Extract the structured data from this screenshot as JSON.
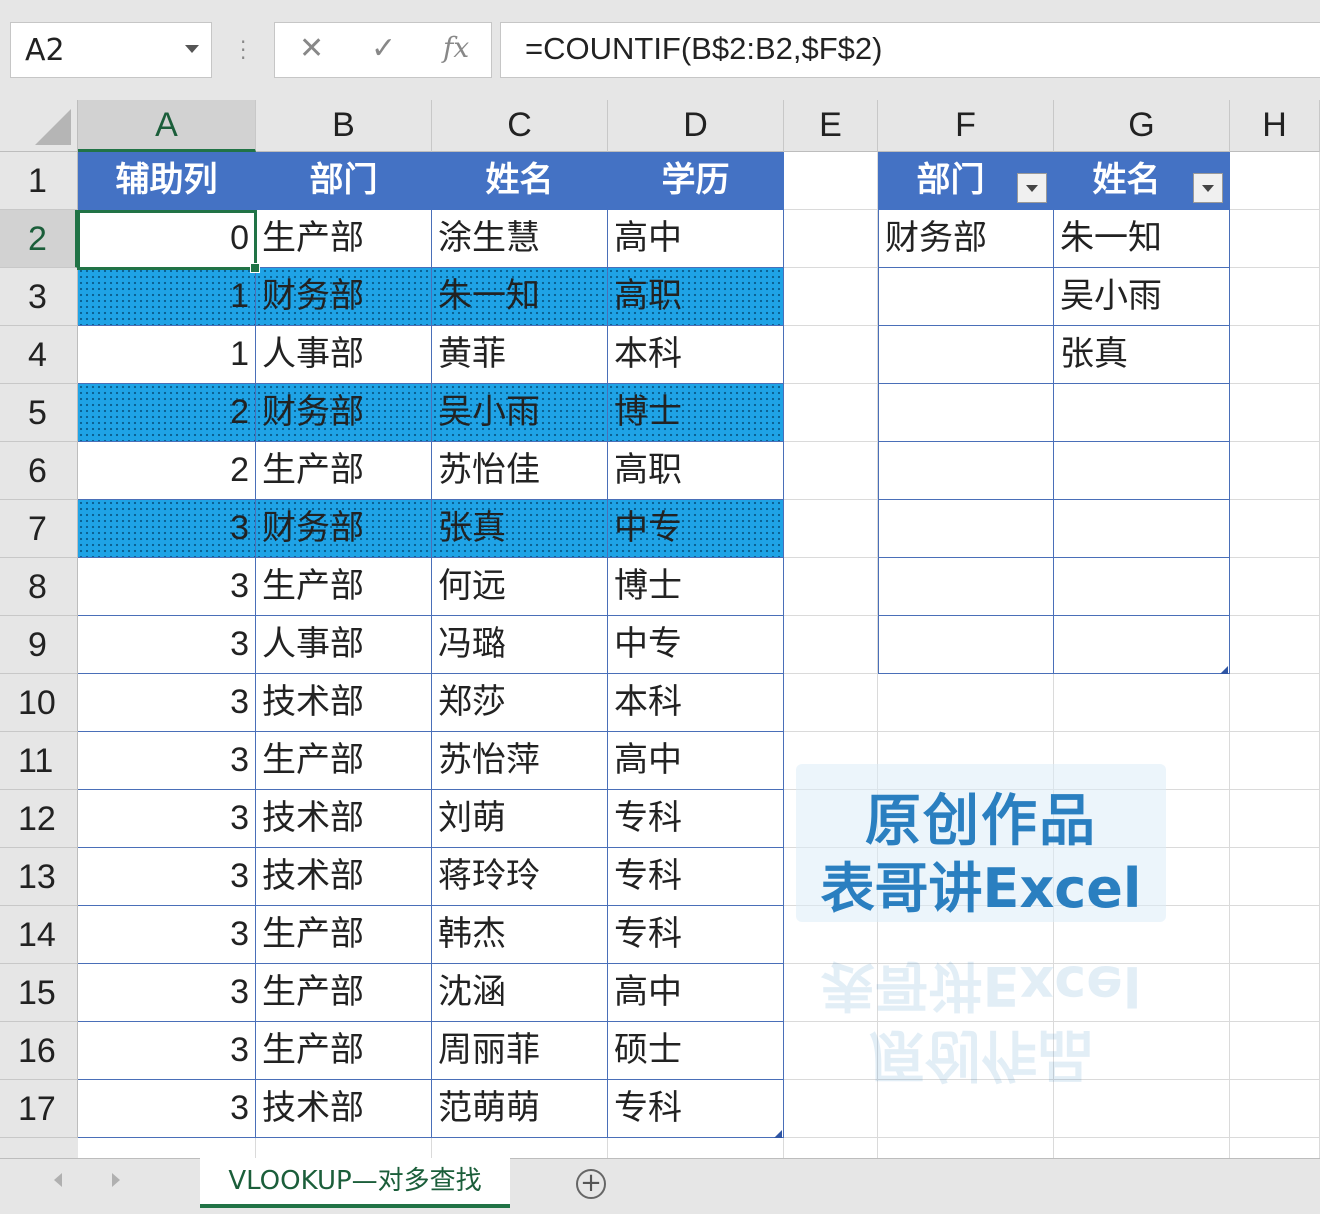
{
  "formula_bar": {
    "name_box": "A2",
    "cancel_glyph": "✕",
    "confirm_glyph": "✓",
    "fx_label": "fx",
    "formula": "=COUNTIF(B$2:B2,$F$2)"
  },
  "columns": [
    "A",
    "B",
    "C",
    "D",
    "E",
    "F",
    "G",
    "H"
  ],
  "rows": [
    "1",
    "2",
    "3",
    "4",
    "5",
    "6",
    "7",
    "8",
    "9",
    "10",
    "11",
    "12",
    "13",
    "14",
    "15",
    "16",
    "17"
  ],
  "main_table": {
    "headers": [
      "辅助列",
      "部门",
      "姓名",
      "学历"
    ],
    "rows": [
      {
        "helper": "0",
        "dept": "生产部",
        "name": "涂生慧",
        "edu": "高中",
        "highlight": false
      },
      {
        "helper": "1",
        "dept": "财务部",
        "name": "朱一知",
        "edu": "高职",
        "highlight": true
      },
      {
        "helper": "1",
        "dept": "人事部",
        "name": "黄菲",
        "edu": "本科",
        "highlight": false
      },
      {
        "helper": "2",
        "dept": "财务部",
        "name": "吴小雨",
        "edu": "博士",
        "highlight": true
      },
      {
        "helper": "2",
        "dept": "生产部",
        "name": "苏怡佳",
        "edu": "高职",
        "highlight": false
      },
      {
        "helper": "3",
        "dept": "财务部",
        "name": "张真",
        "edu": "中专",
        "highlight": true
      },
      {
        "helper": "3",
        "dept": "生产部",
        "name": "何远",
        "edu": "博士",
        "highlight": false
      },
      {
        "helper": "3",
        "dept": "人事部",
        "name": "冯璐",
        "edu": "中专",
        "highlight": false
      },
      {
        "helper": "3",
        "dept": "技术部",
        "name": "郑莎",
        "edu": "本科",
        "highlight": false
      },
      {
        "helper": "3",
        "dept": "生产部",
        "name": "苏怡萍",
        "edu": "高中",
        "highlight": false
      },
      {
        "helper": "3",
        "dept": "技术部",
        "name": "刘萌",
        "edu": "专科",
        "highlight": false
      },
      {
        "helper": "3",
        "dept": "技术部",
        "name": "蒋玲玲",
        "edu": "专科",
        "highlight": false
      },
      {
        "helper": "3",
        "dept": "生产部",
        "name": "韩杰",
        "edu": "专科",
        "highlight": false
      },
      {
        "helper": "3",
        "dept": "生产部",
        "name": "沈涵",
        "edu": "高中",
        "highlight": false
      },
      {
        "helper": "3",
        "dept": "生产部",
        "name": "周丽菲",
        "edu": "硕士",
        "highlight": false
      },
      {
        "helper": "3",
        "dept": "技术部",
        "name": "范萌萌",
        "edu": "专科",
        "highlight": false
      }
    ]
  },
  "lookup_table": {
    "headers": [
      "部门",
      "姓名"
    ],
    "rows": [
      {
        "dept": "财务部",
        "name": "朱一知"
      },
      {
        "dept": "",
        "name": "吴小雨"
      },
      {
        "dept": "",
        "name": "张真"
      },
      {
        "dept": "",
        "name": ""
      },
      {
        "dept": "",
        "name": ""
      },
      {
        "dept": "",
        "name": ""
      },
      {
        "dept": "",
        "name": ""
      },
      {
        "dept": "",
        "name": ""
      }
    ]
  },
  "watermark": {
    "line1": "原创作品",
    "line2": "表哥讲Excel"
  },
  "sheet_tabs": {
    "active": "VLOOKUP—对多查找",
    "add_glyph": "+"
  },
  "colors": {
    "header_blue": "#4472c4",
    "highlight_cyan": "#1fa3e6",
    "excel_green": "#217346"
  }
}
